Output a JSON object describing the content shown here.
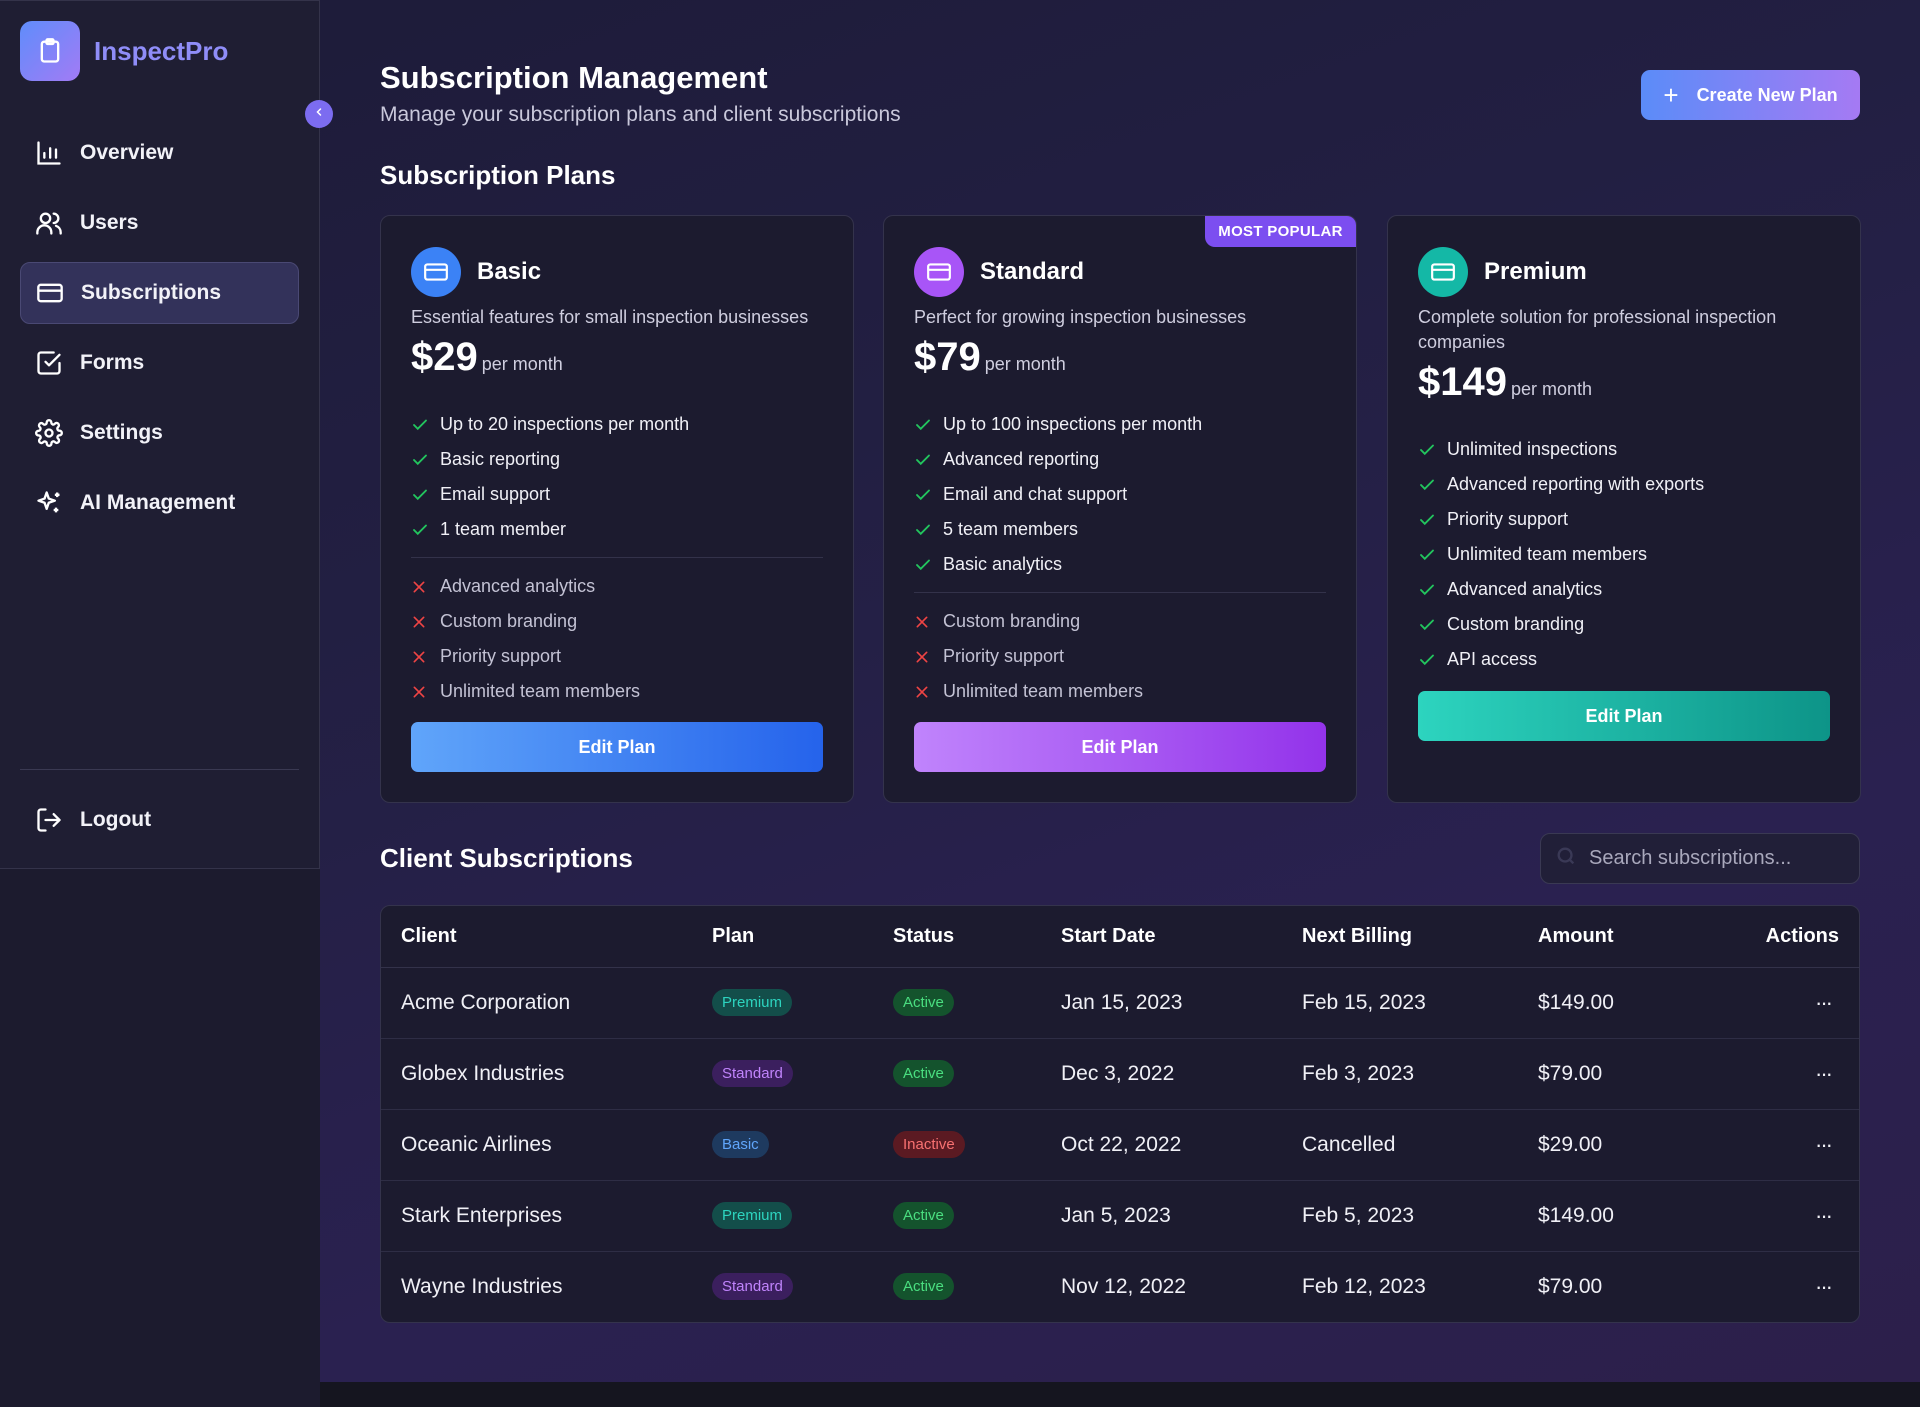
{
  "app": {
    "name": "InspectPro"
  },
  "sidebar": {
    "items": [
      {
        "label": "Overview",
        "icon": "chart-bar-icon"
      },
      {
        "label": "Users",
        "icon": "users-icon"
      },
      {
        "label": "Subscriptions",
        "icon": "credit-card-icon",
        "active": true
      },
      {
        "label": "Forms",
        "icon": "checkbox-icon"
      },
      {
        "label": "Settings",
        "icon": "gear-icon"
      },
      {
        "label": "AI Management",
        "icon": "sparkles-icon"
      }
    ],
    "logout_label": "Logout"
  },
  "header": {
    "title": "Subscription Management",
    "subtitle": "Manage your subscription plans and client subscriptions",
    "create_button": "Create New Plan"
  },
  "plans_section": {
    "title": "Subscription Plans",
    "plans": [
      {
        "name": "Basic",
        "description": "Essential features for small inspection businesses",
        "price": "$29",
        "period": "per month",
        "included": [
          "Up to 20 inspections per month",
          "Basic reporting",
          "Email support",
          "1 team member"
        ],
        "excluded": [
          "Advanced analytics",
          "Custom branding",
          "Priority support",
          "Unlimited team members"
        ],
        "button": "Edit Plan",
        "accent": "#3b82f6"
      },
      {
        "name": "Standard",
        "badge": "MOST POPULAR",
        "description": "Perfect for growing inspection businesses",
        "price": "$79",
        "period": "per month",
        "included": [
          "Up to 100 inspections per month",
          "Advanced reporting",
          "Email and chat support",
          "5 team members",
          "Basic analytics"
        ],
        "excluded": [
          "Custom branding",
          "Priority support",
          "Unlimited team members"
        ],
        "button": "Edit Plan",
        "accent": "#a855f7"
      },
      {
        "name": "Premium",
        "description": "Complete solution for professional inspection companies",
        "price": "$149",
        "period": "per month",
        "included": [
          "Unlimited inspections",
          "Advanced reporting with exports",
          "Priority support",
          "Unlimited team members",
          "Advanced analytics",
          "Custom branding",
          "API access"
        ],
        "excluded": [],
        "button": "Edit Plan",
        "accent": "#14b8a6"
      }
    ]
  },
  "clients_section": {
    "title": "Client Subscriptions",
    "search_placeholder": "Search subscriptions...",
    "columns": [
      "Client",
      "Plan",
      "Status",
      "Start Date",
      "Next Billing",
      "Amount",
      "Actions"
    ],
    "rows": [
      {
        "client": "Acme Corporation",
        "plan": "Premium",
        "status": "Active",
        "start": "Jan 15, 2023",
        "next": "Feb 15, 2023",
        "amount": "$149.00"
      },
      {
        "client": "Globex Industries",
        "plan": "Standard",
        "status": "Active",
        "start": "Dec 3, 2022",
        "next": "Feb 3, 2023",
        "amount": "$79.00"
      },
      {
        "client": "Oceanic Airlines",
        "plan": "Basic",
        "status": "Inactive",
        "start": "Oct 22, 2022",
        "next": "Cancelled",
        "amount": "$29.00"
      },
      {
        "client": "Stark Enterprises",
        "plan": "Premium",
        "status": "Active",
        "start": "Jan 5, 2023",
        "next": "Feb 5, 2023",
        "amount": "$149.00"
      },
      {
        "client": "Wayne Industries",
        "plan": "Standard",
        "status": "Active",
        "start": "Nov 12, 2022",
        "next": "Feb 12, 2023",
        "amount": "$79.00"
      }
    ],
    "actions_label": "···"
  }
}
